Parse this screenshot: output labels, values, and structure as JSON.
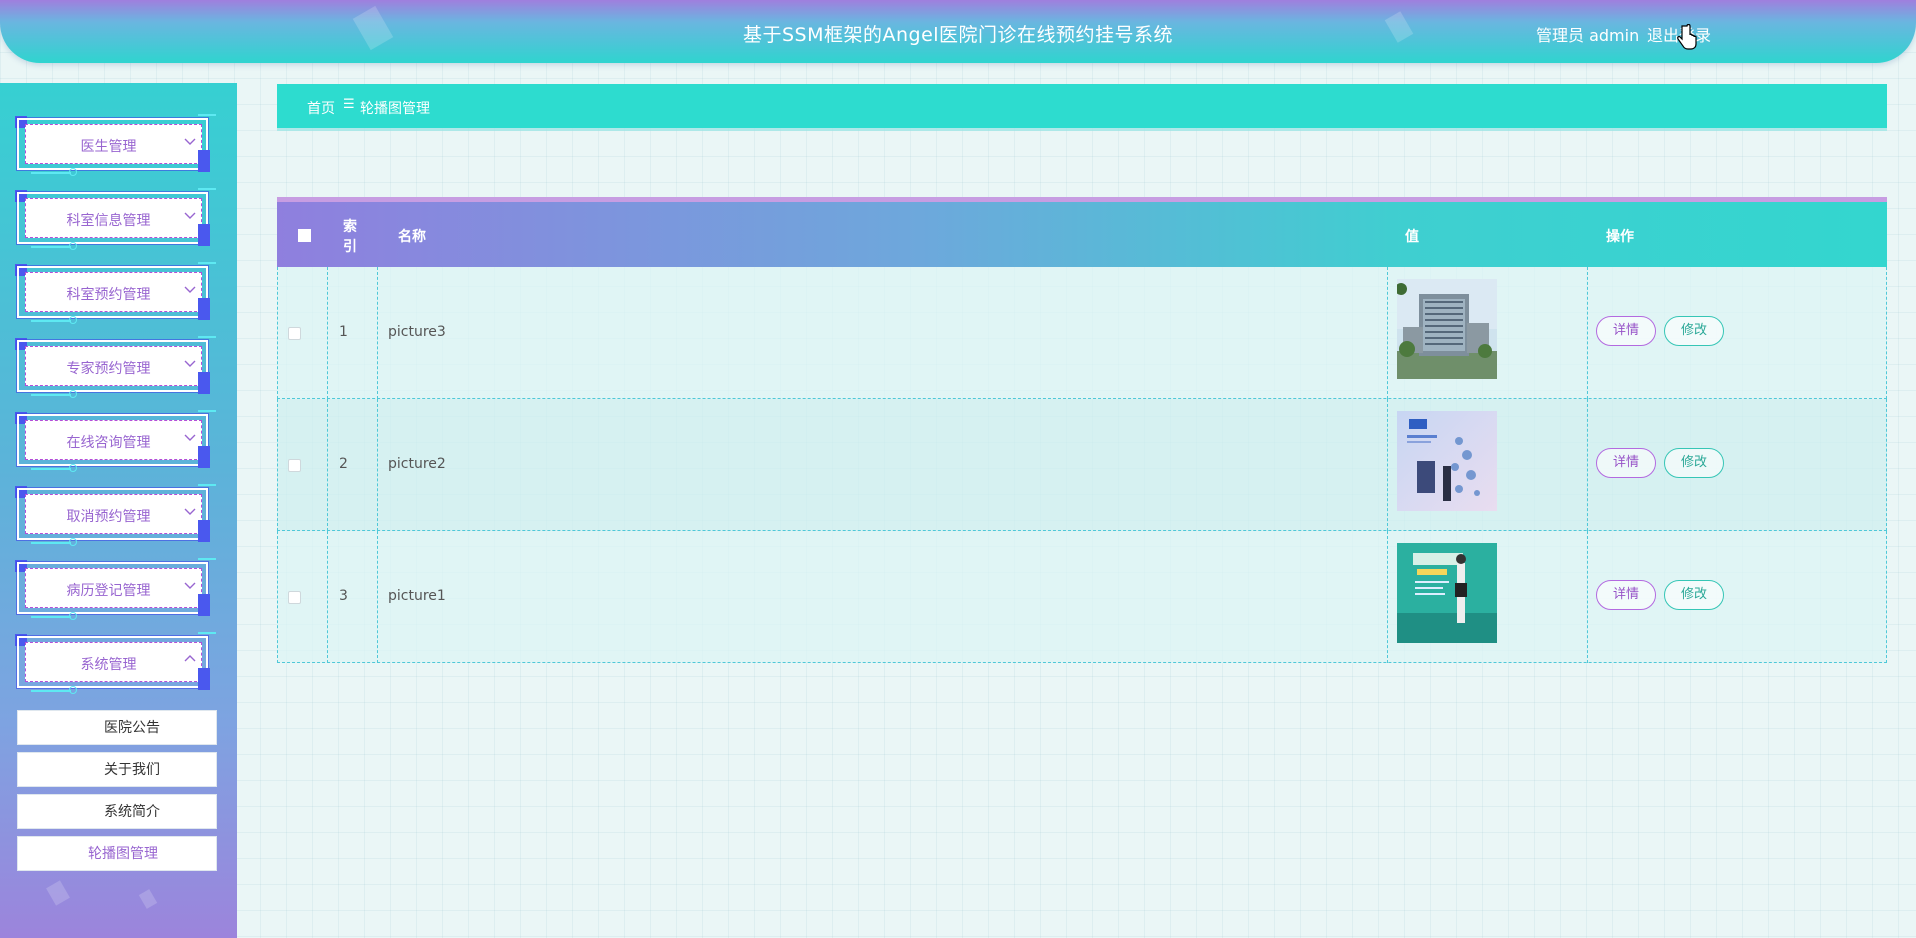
{
  "header": {
    "title": "基于SSM框架的Angel医院门诊在线预约挂号系统",
    "role_label": "管理员 admin",
    "logout_label": "退出登录"
  },
  "sidebar": {
    "menus": [
      {
        "label": "医生管理",
        "icon": "chevron-down-icon"
      },
      {
        "label": "科室信息管理",
        "icon": "chevron-down-icon"
      },
      {
        "label": "科室预约管理",
        "icon": "chevron-down-icon"
      },
      {
        "label": "专家预约管理",
        "icon": "chevron-down-icon"
      },
      {
        "label": "在线咨询管理",
        "icon": "chevron-down-icon"
      },
      {
        "label": "取消预约管理",
        "icon": "chevron-down-icon"
      },
      {
        "label": "病历登记管理",
        "icon": "chevron-down-icon"
      },
      {
        "label": "系统管理",
        "icon": "chevron-up-icon"
      }
    ],
    "submenu": [
      {
        "label": "医院公告"
      },
      {
        "label": "关于我们"
      },
      {
        "label": "系统简介"
      },
      {
        "label": "轮播图管理",
        "active": true
      }
    ]
  },
  "breadcrumb": {
    "home": "首页",
    "separator": "☰",
    "current": "轮播图管理"
  },
  "table": {
    "columns": {
      "index": "索引",
      "name": "名称",
      "value": "值",
      "action": "操作"
    },
    "rows": [
      {
        "index": "1",
        "name": "picture3",
        "image": "hospital-building-image"
      },
      {
        "index": "2",
        "name": "picture2",
        "image": "medical-poster-image"
      },
      {
        "index": "3",
        "name": "picture1",
        "image": "teal-poster-image"
      }
    ],
    "detail_label": "详情",
    "edit_label": "修改"
  },
  "colors": {
    "header_top": "#9f7fde",
    "header_bottom": "#2fd4cf",
    "breadcrumb_bg": "#2ddccf",
    "accent_purple": "#9865d0",
    "accent_teal": "#2aa897"
  }
}
